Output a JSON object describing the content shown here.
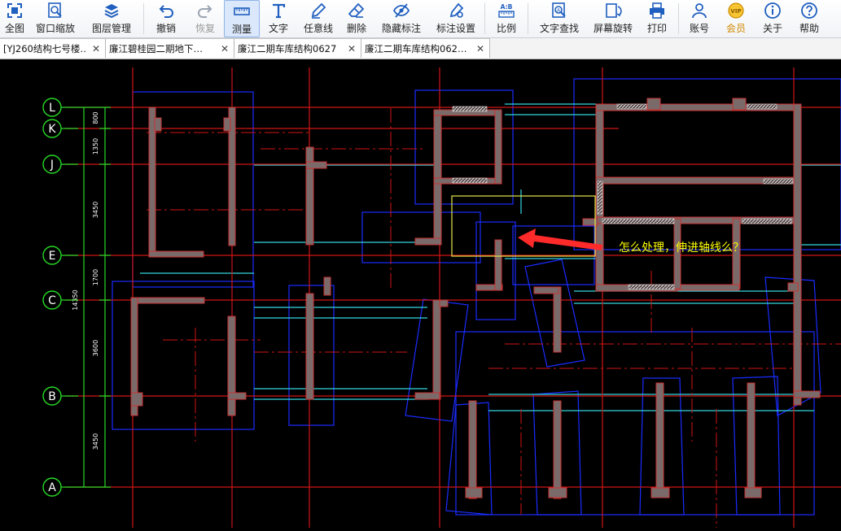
{
  "toolbar": {
    "items": [
      {
        "label": "全图",
        "icon": "fit-all-icon"
      },
      {
        "label": "窗口缩放",
        "icon": "window-zoom-icon"
      },
      {
        "label": "图层管理",
        "icon": "layers-icon"
      },
      {
        "label": "撤销",
        "icon": "undo-icon"
      },
      {
        "label": "恢复",
        "icon": "redo-icon"
      },
      {
        "label": "测量",
        "icon": "measure-icon"
      },
      {
        "label": "文字",
        "icon": "text-icon"
      },
      {
        "label": "任意线",
        "icon": "freehand-line-icon"
      },
      {
        "label": "删除",
        "icon": "eraser-icon"
      },
      {
        "label": "隐藏标注",
        "icon": "hide-annotation-icon"
      },
      {
        "label": "标注设置",
        "icon": "annotation-settings-icon"
      },
      {
        "label": "比例",
        "icon": "scale-icon",
        "icon_text": "A:B"
      },
      {
        "label": "文字查找",
        "icon": "text-search-icon"
      },
      {
        "label": "屏幕旋转",
        "icon": "screen-rotate-icon"
      },
      {
        "label": "打印",
        "icon": "print-icon"
      },
      {
        "label": "账号",
        "icon": "account-icon"
      },
      {
        "label": "会员",
        "icon": "vip-icon",
        "icon_text": "VIP"
      },
      {
        "label": "关于",
        "icon": "about-icon"
      },
      {
        "label": "帮助",
        "icon": "help-icon"
      }
    ],
    "active": "测量",
    "disabled": [
      "恢复"
    ],
    "accent_color": "#1f5fbf",
    "vip_color": "#d18b00"
  },
  "tabs": [
    {
      "title": "[YJ260结构七号楼…",
      "close": "✕"
    },
    {
      "title": "廉江碧桂园二期地下…",
      "close": "✕"
    },
    {
      "title": "廉江二期车库结构0627",
      "close": "✕"
    },
    {
      "title": "廉江二期车库结构062…",
      "close": "✕"
    }
  ],
  "drawing": {
    "axes": [
      "L",
      "K",
      "J",
      "E",
      "C",
      "B",
      "A"
    ],
    "dimensions": [
      "800",
      "1350",
      "3450",
      "1700",
      "14350",
      "3600",
      "3450"
    ],
    "annotation": "怎么处理，伸进轴线么？",
    "colors": {
      "background": "#000000",
      "wall": "#7b6a6a",
      "wall_edge": "#c83232",
      "axis_line": "#d01515",
      "beam_outline": "#1a2cff",
      "cyan_line": "#33d6e0",
      "dimension_line": "#27d927",
      "annotation": "#ffff00",
      "arrow": "#ff2a2a",
      "selection_box": "#e6e64a"
    }
  }
}
